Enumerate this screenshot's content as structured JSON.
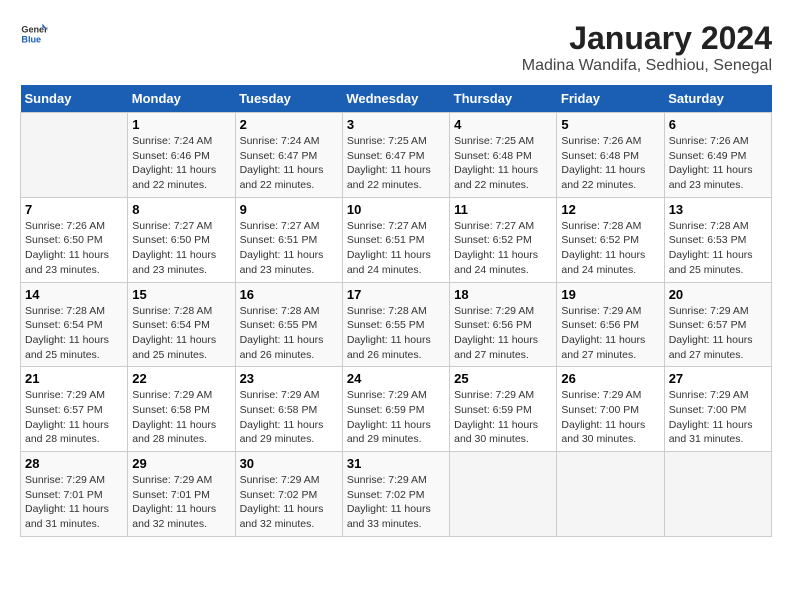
{
  "header": {
    "logo_general": "General",
    "logo_blue": "Blue",
    "title": "January 2024",
    "subtitle": "Madina Wandifa, Sedhiou, Senegal"
  },
  "calendar": {
    "days_of_week": [
      "Sunday",
      "Monday",
      "Tuesday",
      "Wednesday",
      "Thursday",
      "Friday",
      "Saturday"
    ],
    "weeks": [
      [
        {
          "day": "",
          "info": ""
        },
        {
          "day": "1",
          "info": "Sunrise: 7:24 AM\nSunset: 6:46 PM\nDaylight: 11 hours and 22 minutes."
        },
        {
          "day": "2",
          "info": "Sunrise: 7:24 AM\nSunset: 6:47 PM\nDaylight: 11 hours and 22 minutes."
        },
        {
          "day": "3",
          "info": "Sunrise: 7:25 AM\nSunset: 6:47 PM\nDaylight: 11 hours and 22 minutes."
        },
        {
          "day": "4",
          "info": "Sunrise: 7:25 AM\nSunset: 6:48 PM\nDaylight: 11 hours and 22 minutes."
        },
        {
          "day": "5",
          "info": "Sunrise: 7:26 AM\nSunset: 6:48 PM\nDaylight: 11 hours and 22 minutes."
        },
        {
          "day": "6",
          "info": "Sunrise: 7:26 AM\nSunset: 6:49 PM\nDaylight: 11 hours and 23 minutes."
        }
      ],
      [
        {
          "day": "7",
          "info": "Sunrise: 7:26 AM\nSunset: 6:50 PM\nDaylight: 11 hours and 23 minutes."
        },
        {
          "day": "8",
          "info": "Sunrise: 7:27 AM\nSunset: 6:50 PM\nDaylight: 11 hours and 23 minutes."
        },
        {
          "day": "9",
          "info": "Sunrise: 7:27 AM\nSunset: 6:51 PM\nDaylight: 11 hours and 23 minutes."
        },
        {
          "day": "10",
          "info": "Sunrise: 7:27 AM\nSunset: 6:51 PM\nDaylight: 11 hours and 24 minutes."
        },
        {
          "day": "11",
          "info": "Sunrise: 7:27 AM\nSunset: 6:52 PM\nDaylight: 11 hours and 24 minutes."
        },
        {
          "day": "12",
          "info": "Sunrise: 7:28 AM\nSunset: 6:52 PM\nDaylight: 11 hours and 24 minutes."
        },
        {
          "day": "13",
          "info": "Sunrise: 7:28 AM\nSunset: 6:53 PM\nDaylight: 11 hours and 25 minutes."
        }
      ],
      [
        {
          "day": "14",
          "info": "Sunrise: 7:28 AM\nSunset: 6:54 PM\nDaylight: 11 hours and 25 minutes."
        },
        {
          "day": "15",
          "info": "Sunrise: 7:28 AM\nSunset: 6:54 PM\nDaylight: 11 hours and 25 minutes."
        },
        {
          "day": "16",
          "info": "Sunrise: 7:28 AM\nSunset: 6:55 PM\nDaylight: 11 hours and 26 minutes."
        },
        {
          "day": "17",
          "info": "Sunrise: 7:28 AM\nSunset: 6:55 PM\nDaylight: 11 hours and 26 minutes."
        },
        {
          "day": "18",
          "info": "Sunrise: 7:29 AM\nSunset: 6:56 PM\nDaylight: 11 hours and 27 minutes."
        },
        {
          "day": "19",
          "info": "Sunrise: 7:29 AM\nSunset: 6:56 PM\nDaylight: 11 hours and 27 minutes."
        },
        {
          "day": "20",
          "info": "Sunrise: 7:29 AM\nSunset: 6:57 PM\nDaylight: 11 hours and 27 minutes."
        }
      ],
      [
        {
          "day": "21",
          "info": "Sunrise: 7:29 AM\nSunset: 6:57 PM\nDaylight: 11 hours and 28 minutes."
        },
        {
          "day": "22",
          "info": "Sunrise: 7:29 AM\nSunset: 6:58 PM\nDaylight: 11 hours and 28 minutes."
        },
        {
          "day": "23",
          "info": "Sunrise: 7:29 AM\nSunset: 6:58 PM\nDaylight: 11 hours and 29 minutes."
        },
        {
          "day": "24",
          "info": "Sunrise: 7:29 AM\nSunset: 6:59 PM\nDaylight: 11 hours and 29 minutes."
        },
        {
          "day": "25",
          "info": "Sunrise: 7:29 AM\nSunset: 6:59 PM\nDaylight: 11 hours and 30 minutes."
        },
        {
          "day": "26",
          "info": "Sunrise: 7:29 AM\nSunset: 7:00 PM\nDaylight: 11 hours and 30 minutes."
        },
        {
          "day": "27",
          "info": "Sunrise: 7:29 AM\nSunset: 7:00 PM\nDaylight: 11 hours and 31 minutes."
        }
      ],
      [
        {
          "day": "28",
          "info": "Sunrise: 7:29 AM\nSunset: 7:01 PM\nDaylight: 11 hours and 31 minutes."
        },
        {
          "day": "29",
          "info": "Sunrise: 7:29 AM\nSunset: 7:01 PM\nDaylight: 11 hours and 32 minutes."
        },
        {
          "day": "30",
          "info": "Sunrise: 7:29 AM\nSunset: 7:02 PM\nDaylight: 11 hours and 32 minutes."
        },
        {
          "day": "31",
          "info": "Sunrise: 7:29 AM\nSunset: 7:02 PM\nDaylight: 11 hours and 33 minutes."
        },
        {
          "day": "",
          "info": ""
        },
        {
          "day": "",
          "info": ""
        },
        {
          "day": "",
          "info": ""
        }
      ]
    ]
  }
}
